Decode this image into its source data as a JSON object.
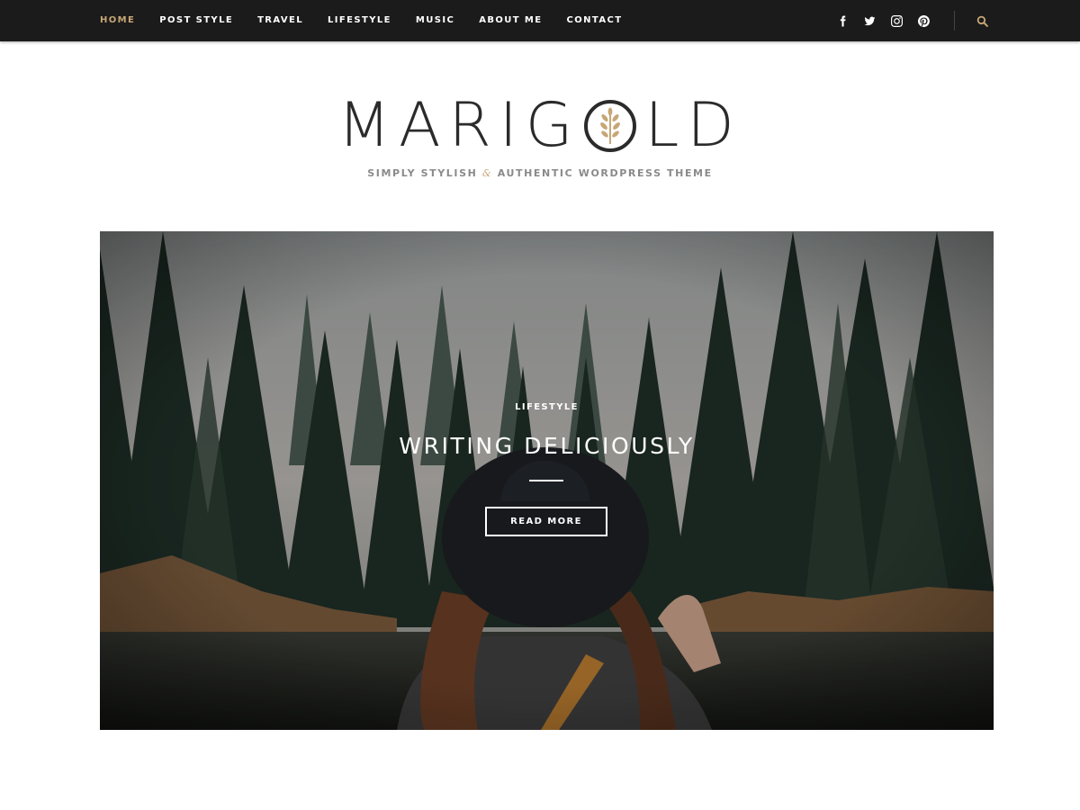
{
  "nav": {
    "items": [
      {
        "label": "HOME",
        "active": true
      },
      {
        "label": "POST STYLE",
        "active": false
      },
      {
        "label": "TRAVEL",
        "active": false
      },
      {
        "label": "LIFESTYLE",
        "active": false
      },
      {
        "label": "MUSIC",
        "active": false
      },
      {
        "label": "ABOUT ME",
        "active": false
      },
      {
        "label": "CONTACT",
        "active": false
      }
    ],
    "social_icons": [
      "facebook-icon",
      "twitter-icon",
      "instagram-icon",
      "pinterest-icon"
    ],
    "search_icon": "search-icon"
  },
  "header": {
    "logo_text_left": "MARIG",
    "logo_text_right": "LD",
    "tagline_part1": "SIMPLY STYLISH",
    "tagline_amp": "&",
    "tagline_part2": "AUTHENTIC WORDPRESS THEME"
  },
  "hero": {
    "category": "LIFESTYLE",
    "title": "WRITING DELICIOUSLY",
    "button_label": "READ MORE"
  },
  "colors": {
    "topbar_bg": "#1b1b1b",
    "accent": "#c7a676",
    "text_dark": "#2b2b2b",
    "tagline": "#8a8a8a"
  }
}
